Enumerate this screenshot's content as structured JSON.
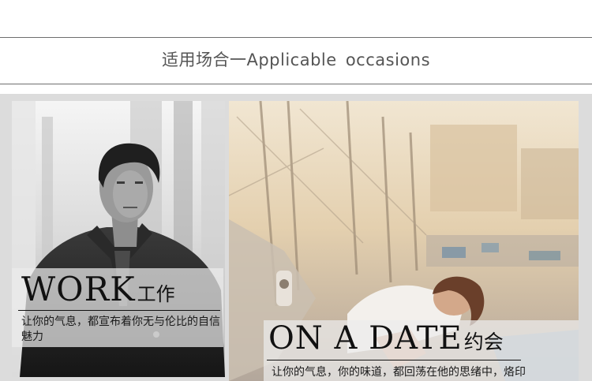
{
  "header": {
    "title": "适用场合一Applicable  occasions"
  },
  "panels": {
    "work": {
      "title_en": "WORK",
      "title_zh": "工作",
      "description": "让你的气息，都宣布着你无与伦比的自信魅力"
    },
    "date": {
      "title_en": "ON A DATE",
      "title_zh": "约会",
      "description": "让你的气息，你的味道，都回荡在他的思绪中，烙印在他的记忆里"
    }
  },
  "colors": {
    "rule": "#6e6e6e",
    "title_text": "#555555",
    "gallery_bg": "#dcdcdc",
    "caption_bg": "rgba(235,235,235,0.72)",
    "caption_text": "#111111"
  }
}
